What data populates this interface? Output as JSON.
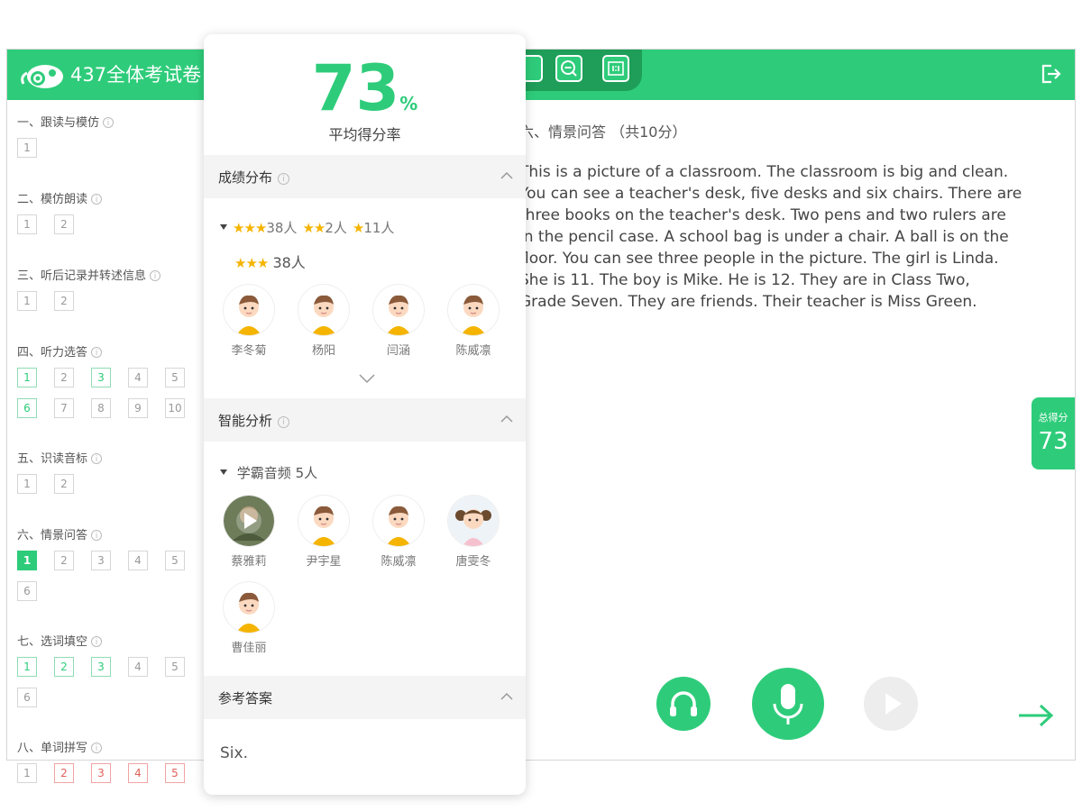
{
  "app": {
    "title": "437全体考试卷",
    "colors": {
      "primary": "#2ecc7a",
      "dark": "#1e9e58",
      "red": "#e0605a"
    }
  },
  "sidebar": {
    "sections": [
      {
        "title": "一、跟读与模仿",
        "items": [
          {
            "n": "1",
            "s": "plain"
          }
        ]
      },
      {
        "title": "二、模仿朗读",
        "items": [
          {
            "n": "1",
            "s": "plain"
          },
          {
            "n": "2",
            "s": "plain"
          }
        ]
      },
      {
        "title": "三、听后记录并转述信息",
        "items": [
          {
            "n": "1",
            "s": "plain"
          },
          {
            "n": "2",
            "s": "plain"
          }
        ]
      },
      {
        "title": "四、听力选答",
        "items": [
          {
            "n": "1",
            "s": "green"
          },
          {
            "n": "2",
            "s": "plain"
          },
          {
            "n": "3",
            "s": "green"
          },
          {
            "n": "4",
            "s": "plain"
          },
          {
            "n": "5",
            "s": "plain"
          },
          {
            "n": "6",
            "s": "green"
          },
          {
            "n": "7",
            "s": "plain"
          },
          {
            "n": "8",
            "s": "plain"
          },
          {
            "n": "9",
            "s": "plain"
          },
          {
            "n": "10",
            "s": "plain"
          }
        ]
      },
      {
        "title": "五、识读音标",
        "items": [
          {
            "n": "1",
            "s": "plain"
          },
          {
            "n": "2",
            "s": "plain"
          }
        ]
      },
      {
        "title": "六、情景问答",
        "items": [
          {
            "n": "1",
            "s": "active"
          },
          {
            "n": "2",
            "s": "plain"
          },
          {
            "n": "3",
            "s": "plain"
          },
          {
            "n": "4",
            "s": "plain"
          },
          {
            "n": "5",
            "s": "plain"
          },
          {
            "n": "6",
            "s": "plain"
          }
        ]
      },
      {
        "title": "七、选词填空",
        "items": [
          {
            "n": "1",
            "s": "green"
          },
          {
            "n": "2",
            "s": "green"
          },
          {
            "n": "3",
            "s": "green"
          },
          {
            "n": "4",
            "s": "plain"
          },
          {
            "n": "5",
            "s": "plain"
          },
          {
            "n": "6",
            "s": "plain"
          }
        ]
      },
      {
        "title": "八、单词拼写",
        "items": [
          {
            "n": "1",
            "s": "plain"
          },
          {
            "n": "2",
            "s": "red"
          },
          {
            "n": "3",
            "s": "red"
          },
          {
            "n": "4",
            "s": "red"
          },
          {
            "n": "5",
            "s": "red"
          }
        ]
      }
    ]
  },
  "main": {
    "heading": "六、情景问答 （共10分）",
    "passage_lines": [
      "This is a picture of a classroom. The classroom is big and clean.",
      "You can see a teacher's desk, five desks and six chairs. There are",
      "three books on the teacher's desk. Two pens and two rulers are",
      "in the pencil case. A school bag is under a chair. A ball is on the",
      "floor. You can see three people in the picture. The girl is Linda.",
      "She is 11. The boy is Mike. He is 12. They are in Class Two,",
      "Grade Seven. They are friends. Their teacher is Miss Green."
    ],
    "total_label": "总得分",
    "total_score": "73"
  },
  "popup": {
    "score": "73",
    "score_unit": "%",
    "score_label": "平均得分率",
    "distribution": {
      "title": "成绩分布",
      "summary": [
        {
          "stars": "★★★",
          "count": "38人"
        },
        {
          "stars": "★★",
          "count": "2人"
        },
        {
          "stars": "★",
          "count": "11人"
        }
      ],
      "group_stars": "★★★",
      "group_count": "38人",
      "students": [
        "李冬菊",
        "杨阳",
        "闫涵",
        "陈威凛"
      ]
    },
    "analysis": {
      "title": "智能分析",
      "group_label": "学霸音频",
      "group_count": "5人",
      "students": [
        {
          "name": "蔡雅莉",
          "type": "play"
        },
        {
          "name": "尹宇星",
          "type": "boy"
        },
        {
          "name": "陈威凛",
          "type": "boy"
        },
        {
          "name": "唐雯冬",
          "type": "girl"
        },
        {
          "name": "曹佳丽",
          "type": "boy"
        }
      ]
    },
    "answer": {
      "title": "参考答案",
      "text": "Six."
    }
  }
}
